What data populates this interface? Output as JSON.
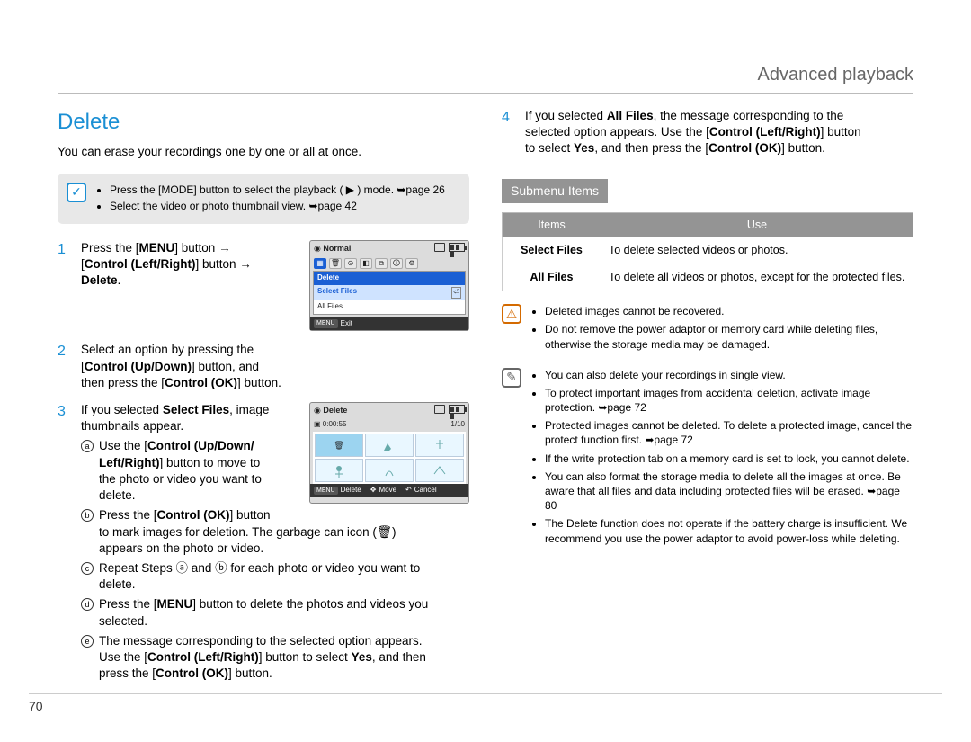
{
  "header": {
    "title": "Advanced playback"
  },
  "page_number": "70",
  "left": {
    "section_title": "Delete",
    "intro": "You can erase your recordings one by one or all at once.",
    "top_note": {
      "items": [
        "Press the [MODE] button to select the playback ( ▶ ) mode. ➥page 26",
        "Select the video or photo thumbnail view. ➥page 42"
      ]
    },
    "steps": {
      "s1": {
        "num": "1",
        "l1a": "Press the [",
        "l1b": "MENU",
        "l1c": "] button ",
        "l2a": "[",
        "l2b": "Control (Left/Right)",
        "l2c": "] button ",
        "l3": "Delete",
        "l3b": "."
      },
      "s2": {
        "num": "2",
        "t1": "Select an option by pressing the",
        "t2a": "[",
        "t2b": "Control (Up/Down)",
        "t2c": "] button, and",
        "t3a": "then press the [",
        "t3b": "Control (OK)",
        "t3c": "] button."
      },
      "s3": {
        "num": "3",
        "t1a": "If you selected ",
        "t1b": "Select Files",
        "t1c": ", image",
        "t1d": "thumbnails appear.",
        "a": {
          "l1": "Use the [",
          "l2": "Control (Up/Down/",
          "l3": "Left/Right)",
          "l4": "] button to move to",
          "l5": "the photo or video you want to",
          "l6": "delete."
        },
        "b": {
          "l1": "Press the [",
          "l2": "Control (OK)",
          "l3": "] button",
          "l4": "to mark images for deletion. The garbage can icon (🗑)",
          "l5": "appears on the photo or video."
        },
        "c": {
          "l1": "Repeat Steps ⓐ and ⓑ for each photo or video you want to",
          "l2": "delete."
        },
        "d": {
          "l1": "Press the [",
          "l2": "MENU",
          "l3": "] button to delete the photos and videos you",
          "l4": "selected."
        },
        "e": {
          "l1": "The message corresponding to the selected option appears.",
          "l2": "Use the [",
          "l3": "Control (Left/Right)",
          "l4": "] button to select ",
          "l5": "Yes",
          "l6": ", and then",
          "l7": "press the [",
          "l8": "Control (OK)",
          "l9": "] button."
        }
      }
    },
    "screen1": {
      "topL": "Normal",
      "menu_header": "Delete",
      "item1": "Select Files",
      "item2": "All Files",
      "bot_k": "MENU",
      "bot_l": "Exit"
    },
    "screen2": {
      "title": "Delete",
      "time": "0:00:55",
      "count": "1/10",
      "bot1k": "MENU",
      "bot1": "Delete",
      "bot2": "Move",
      "bot3": "Cancel"
    }
  },
  "right": {
    "step4": {
      "num": "4",
      "l1a": "If you selected ",
      "l1b": "All Files",
      "l1c": ", the message corresponding to the",
      "l2a": "selected option appears. Use the [",
      "l2b": "Control (Left/Right)",
      "l2c": "] button",
      "l3a": "to select ",
      "l3b": "Yes",
      "l3c": ", and then press the [",
      "l3d": "Control (OK)",
      "l3e": "] button."
    },
    "submenu_heading": "Submenu Items",
    "table": {
      "h1": "Items",
      "h2": "Use",
      "r1a": "Select Files",
      "r1b": "To delete selected videos or photos.",
      "r2a": "All Files",
      "r2b": "To delete all videos or photos, except for the protected files."
    },
    "warn": {
      "i1": "Deleted images cannot be recovered.",
      "i2": "Do not remove the power adaptor or memory card while deleting files, otherwise the storage media may be damaged."
    },
    "info": {
      "i1": "You can also delete your recordings in single view.",
      "i2": "To protect important images from accidental deletion, activate image protection. ➥page 72",
      "i3": "Protected images cannot be deleted. To delete a protected image, cancel the protect function first. ➥page 72",
      "i4": "If the write protection tab on a memory card is set to lock, you cannot delete.",
      "i5": "You can also format the storage media to delete all the images at once. Be aware that all files and data including protected files will be erased. ➥page 80",
      "i6": "The Delete function does not operate if the battery charge is insufficient. We recommend you use the power adaptor to avoid power-loss while deleting."
    }
  }
}
